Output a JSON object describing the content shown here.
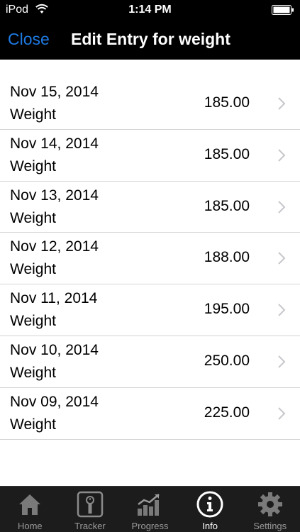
{
  "status_bar": {
    "carrier": "iPod",
    "time": "1:14 PM"
  },
  "nav": {
    "close_label": "Close",
    "title": "Edit Entry for weight"
  },
  "entries": [
    {
      "date": "Nov 15, 2014",
      "label": "Weight",
      "value": "185.00"
    },
    {
      "date": "Nov 14, 2014",
      "label": "Weight",
      "value": "185.00"
    },
    {
      "date": "Nov 13, 2014",
      "label": "Weight",
      "value": "185.00"
    },
    {
      "date": "Nov 12, 2014",
      "label": "Weight",
      "value": "188.00"
    },
    {
      "date": "Nov 11, 2014",
      "label": "Weight",
      "value": "195.00"
    },
    {
      "date": "Nov 10, 2014",
      "label": "Weight",
      "value": "250.00"
    },
    {
      "date": "Nov 09, 2014",
      "label": "Weight",
      "value": "225.00"
    }
  ],
  "tabs": [
    {
      "label": "Home",
      "icon": "home-icon",
      "active": false
    },
    {
      "label": "Tracker",
      "icon": "scale-icon",
      "active": false
    },
    {
      "label": "Progress",
      "icon": "chart-icon",
      "active": false
    },
    {
      "label": "Info",
      "icon": "info-icon",
      "active": true
    },
    {
      "label": "Settings",
      "icon": "gear-icon",
      "active": false
    }
  ],
  "colors": {
    "accent": "#1e7ae3",
    "bar_background": "#000000",
    "tab_bar_background": "#1c1c1c"
  }
}
